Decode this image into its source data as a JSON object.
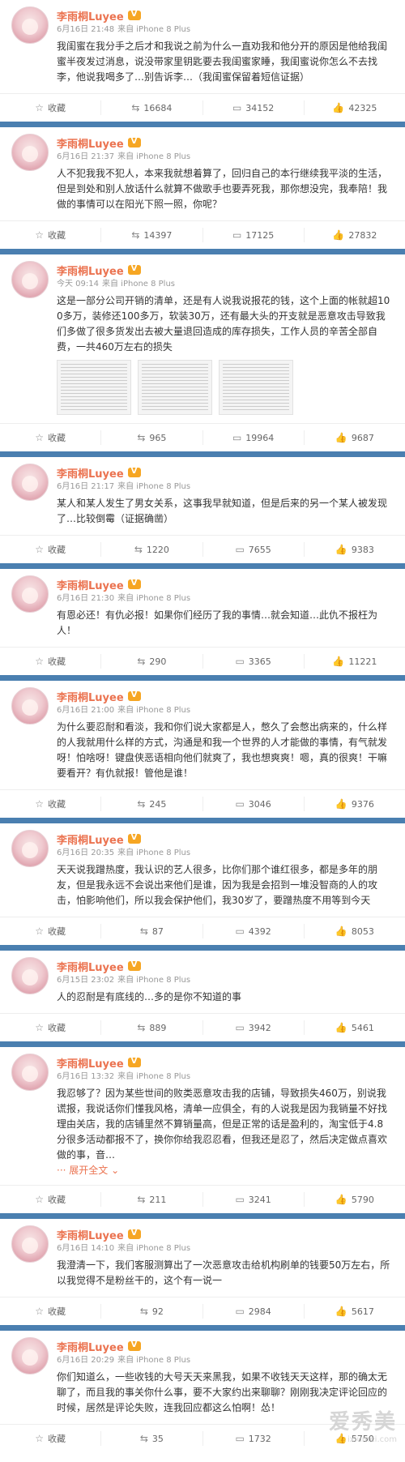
{
  "posts": [
    {
      "name": "李雨桐Luyee",
      "date": "6月16日 21:48",
      "source": "来自 iPhone 8 Plus",
      "text": "我闺蜜在我分手之后才和我说之前为什么一直劝我和他分开的原因是他给我闺蜜半夜发过消息，说没带家里钥匙要去我闺蜜家睡，我闺蜜说你怎么不去找李，他说我喝多了…别告诉李…（我闺蜜保留着短信证据）",
      "fav": "收藏",
      "share": "16684",
      "comment": "34152",
      "like": "42325"
    },
    {
      "name": "李雨桐Luyee",
      "date": "6月16日 21:37",
      "source": "来自 iPhone 8 Plus",
      "text": "人不犯我我不犯人，本来我就想着算了，回归自己的本行继续我平淡的生活，但是到处和别人放话什么就算不做歌手也要弄死我，那你想没完，我奉陪！我做的事情可以在阳光下照一照，你呢？",
      "fav": "收藏",
      "share": "14397",
      "comment": "17125",
      "like": "27832"
    },
    {
      "name": "李雨桐Luyee",
      "date": "今天 09:14",
      "source": "来自 iPhone 8 Plus",
      "text": "这是一部分公司开销的清单，还是有人说我说报花的钱，这个上面的帐就超100多万，装修还100多万，软装30万，还有最大头的开支就是恶意攻击导致我们多做了很多货发出去被大量退回造成的库存损失，工作人员的辛苦全部自费，一共460万左右的损失",
      "fav": "收藏",
      "share": "965",
      "comment": "19964",
      "like": "9687"
    },
    {
      "name": "李雨桐Luyee",
      "date": "6月16日 21:17",
      "source": "来自 iPhone 8 Plus",
      "text": "某人和某人发生了男女关系，这事我早就知道，但是后来的另一个某人被发现了…比较倒霉（证据确凿）",
      "fav": "收藏",
      "share": "1220",
      "comment": "7655",
      "like": "9383"
    },
    {
      "name": "李雨桐Luyee",
      "date": "6月16日 21:30",
      "source": "来自 iPhone 8 Plus",
      "text": "有恩必还！有仇必报！如果你们经历了我的事情…就会知道…此仇不报枉为人！",
      "fav": "收藏",
      "share": "290",
      "comment": "3365",
      "like": "11221"
    },
    {
      "name": "李雨桐Luyee",
      "date": "6月16日 21:00",
      "source": "来自 iPhone 8 Plus",
      "text": "为什么要忍耐和看淡，我和你们说大家都是人，憋久了会憋出病来的，什么样的人我就用什么样的方式，沟通是和我一个世界的人才能做的事情，有气就发呀！怕啥呀！键盘侠恶语相向他们就爽了，我也想爽爽！嗯，真的很爽！干嘛要看开？有仇就报！管他是谁！",
      "fav": "收藏",
      "share": "245",
      "comment": "3046",
      "like": "9376"
    },
    {
      "name": "李雨桐Luyee",
      "date": "6月16日 20:35",
      "source": "来自 iPhone 8 Plus",
      "text": "天天说我蹭热度，我认识的艺人很多，比你们那个谁红很多，都是多年的朋友，但是我永远不会说出来他们是谁，因为我是会招到一堆没智商的人的攻击，怕影响他们，所以我会保护他们，我30岁了，要蹭热度不用等到今天",
      "fav": "收藏",
      "share": "87",
      "comment": "4392",
      "like": "8053"
    },
    {
      "name": "李雨桐Luyee",
      "date": "6月15日 23:02",
      "source": "来自 iPhone 8 Plus",
      "text": "人的忍耐是有底线的…多的是你不知道的事",
      "fav": "收藏",
      "share": "889",
      "comment": "3942",
      "like": "5461"
    },
    {
      "name": "李雨桐Luyee",
      "date": "6月16日 13:32",
      "source": "来自 iPhone 8 Plus",
      "text": "我忍够了？因为某些世间的败类恶意攻击我的店铺，导致损失460万，别说我谎报，我说话你们懂我风格，清单一应俱全，有的人说我是因为我销量不好找理由关店，我的店铺里然不算销量高，但是正常的话是盈利的，淘宝低于4.8分很多活动都报不了，换你你给我忍忍看，但我还是忍了，然后决定做点喜欢做的事，音…",
      "expand": "展开全文",
      "fav": "收藏",
      "share": "211",
      "comment": "3241",
      "like": "5790"
    },
    {
      "name": "李雨桐Luyee",
      "date": "6月16日 14:10",
      "source": "来自 iPhone 8 Plus",
      "text": "我澄清一下，我们客服测算出了一次恶意攻击给机构刷单的钱要50万左右，所以我觉得不是粉丝干的，这个有一说一",
      "fav": "收藏",
      "share": "92",
      "comment": "2984",
      "like": "5617"
    },
    {
      "name": "李雨桐Luyee",
      "date": "6月16日 20:29",
      "source": "来自 iPhone 8 Plus",
      "text": "你们知道么，一些收钱的大号天天来黑我，如果不收钱天天这样，那的确太无聊了，而且我的事关你什么事，要不大家约出来聊聊？刚刚我决定评论回应的时候，居然是评论失败，连我回应都这么怕啊！怂！",
      "fav": "收藏",
      "share": "35",
      "comment": "1732",
      "like": "5750"
    }
  ],
  "watermark": {
    "main": "爱秀美",
    "sub": "ixiumei.com"
  }
}
